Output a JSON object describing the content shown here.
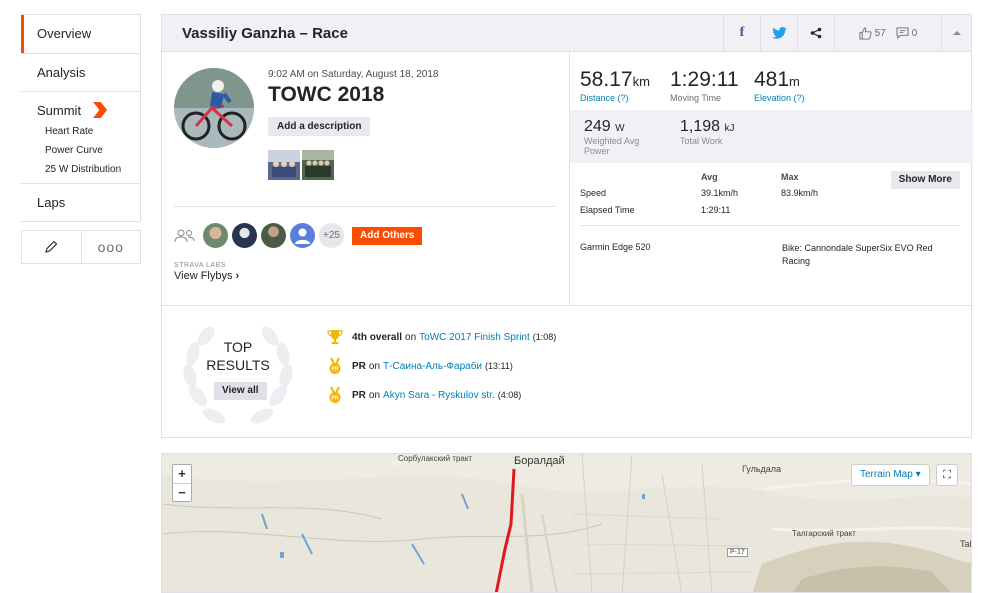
{
  "sidebar": {
    "items": [
      {
        "label": "Overview"
      },
      {
        "label": "Analysis"
      },
      {
        "label": "Summit"
      },
      {
        "label": "Laps"
      }
    ],
    "summit_sub": [
      "Heart Rate",
      "Power Curve",
      "25 W Distribution"
    ],
    "actions": {
      "more": "ooo"
    }
  },
  "header": {
    "title": "Vassiliy Ganzha – Race",
    "fb": "f",
    "kudos_count": "57",
    "comments_count": "0"
  },
  "activity": {
    "date": "9:02 AM on Saturday, August 18, 2018",
    "title": "TOWC 2018",
    "add_description": "Add a description",
    "plus_count": "+25",
    "add_others": "Add Others",
    "labs": "STRAVA LABS",
    "flyby": "View Flybys",
    "flyby_chevron": "›"
  },
  "stats": {
    "distance": {
      "value": "58.17",
      "unit": "km",
      "label": "Distance (?)"
    },
    "moving_time": {
      "value": "1:29:11",
      "label": "Moving Time"
    },
    "elevation": {
      "value": "481",
      "unit": "m",
      "label": "Elevation (?)"
    },
    "power": {
      "value": "249",
      "unit": "W",
      "label1": "Weighted Avg",
      "label2": "Power"
    },
    "work": {
      "value": "1,198",
      "unit": "kJ",
      "label": "Total Work"
    },
    "table": {
      "avg_header": "Avg",
      "max_header": "Max",
      "speed_label": "Speed",
      "speed_avg": "39.1km/h",
      "speed_max": "83.9km/h",
      "elapsed_label": "Elapsed Time",
      "elapsed_avg": "1:29:11"
    },
    "show_more": "Show More",
    "device": "Garmin Edge 520",
    "bike": "Bike: Cannondale SuperSix EVO Red Racing"
  },
  "results": {
    "top_line1": "TOP",
    "top_line2": "RESULTS",
    "view_all": "View all",
    "items": [
      {
        "bold": "4th overall",
        "on": "on",
        "segment": "ToWC 2017 Finish Sprint",
        "time": "(1:08)"
      },
      {
        "bold": "PR",
        "on": "on",
        "segment": "Т-Саина-Аль-Фараби",
        "time": "(13:11)"
      },
      {
        "bold": "PR",
        "on": "on",
        "segment": "Akyn Sara - Ryskulov str.",
        "time": "(4:08)"
      }
    ]
  },
  "map": {
    "zoom_in": "+",
    "zoom_out": "−",
    "terrain": "Terrain Map ▾",
    "fullscreen": "⛶",
    "labels": {
      "boraldai": "Боралдай",
      "sorbulak": "Сорбулакский тракт",
      "guldala": "Гульдала",
      "talgar": "Талгарский тракт",
      "road": "Р-17",
      "tal": "Tal"
    }
  },
  "colors": {
    "accent": "#fc4c02",
    "link": "#007fb6",
    "route": "#e0181e"
  }
}
